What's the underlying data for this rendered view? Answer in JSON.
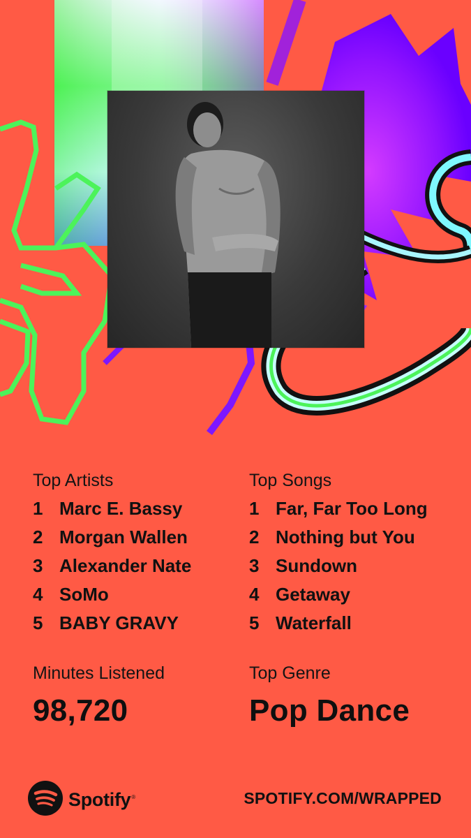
{
  "theme": {
    "background": "#ff5a45",
    "accent_green": "#4cf35a",
    "accent_purple": "#8a14ff"
  },
  "top_artists": {
    "label": "Top Artists",
    "items": [
      {
        "rank": "1",
        "name": "Marc E. Bassy"
      },
      {
        "rank": "2",
        "name": "Morgan Wallen"
      },
      {
        "rank": "3",
        "name": "Alexander Nate"
      },
      {
        "rank": "4",
        "name": "SoMo"
      },
      {
        "rank": "5",
        "name": "BABY GRAVY"
      }
    ]
  },
  "top_songs": {
    "label": "Top Songs",
    "items": [
      {
        "rank": "1",
        "name": "Far, Far Too Long"
      },
      {
        "rank": "2",
        "name": "Nothing but You"
      },
      {
        "rank": "3",
        "name": "Sundown"
      },
      {
        "rank": "4",
        "name": "Getaway"
      },
      {
        "rank": "5",
        "name": "Waterfall"
      }
    ]
  },
  "minutes": {
    "label": "Minutes Listened",
    "value": "98,720"
  },
  "genre": {
    "label": "Top Genre",
    "value": "Pop Dance"
  },
  "footer": {
    "logo_text": "Spotify",
    "logo_icon": "spotify-logo-icon",
    "url": "SPOTIFY.COM/WRAPPED"
  }
}
